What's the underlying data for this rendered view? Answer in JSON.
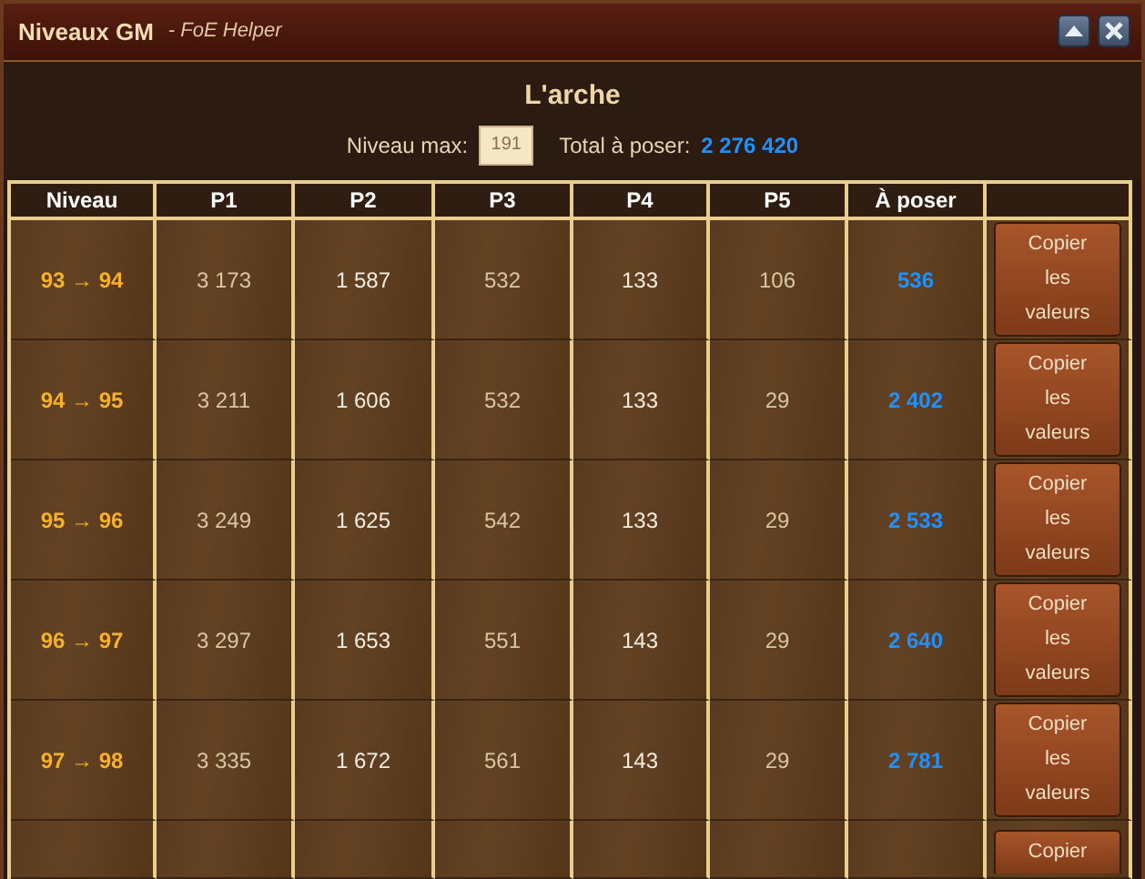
{
  "window": {
    "title": "Niveaux GM",
    "subtitle": "- FoE Helper"
  },
  "header": {
    "title": "L'arche",
    "max_level_label": "Niveau max:",
    "max_level_value": "191",
    "total_label": "Total à poser:",
    "total_value": "2 276 420"
  },
  "table": {
    "columns": [
      "Niveau",
      "P1",
      "P2",
      "P3",
      "P4",
      "P5",
      "À poser"
    ],
    "rows": [
      {
        "level": "93 → 94",
        "p1": "3 173",
        "p2": "1 587",
        "p3": "532",
        "p4": "133",
        "p5": "106",
        "to_place": "536",
        "button": "Copier les valeurs"
      },
      {
        "level": "94 → 95",
        "p1": "3 211",
        "p2": "1 606",
        "p3": "532",
        "p4": "133",
        "p5": "29",
        "to_place": "2 402",
        "button": "Copier les valeurs"
      },
      {
        "level": "95 → 96",
        "p1": "3 249",
        "p2": "1 625",
        "p3": "542",
        "p4": "133",
        "p5": "29",
        "to_place": "2 533",
        "button": "Copier les valeurs"
      },
      {
        "level": "96 → 97",
        "p1": "3 297",
        "p2": "1 653",
        "p3": "551",
        "p4": "143",
        "p5": "29",
        "to_place": "2 640",
        "button": "Copier les valeurs"
      },
      {
        "level": "97 → 98",
        "p1": "3 335",
        "p2": "1 672",
        "p3": "561",
        "p4": "143",
        "p5": "29",
        "to_place": "2 781",
        "button": "Copier les valeurs"
      },
      {
        "button": "Copier"
      }
    ]
  }
}
